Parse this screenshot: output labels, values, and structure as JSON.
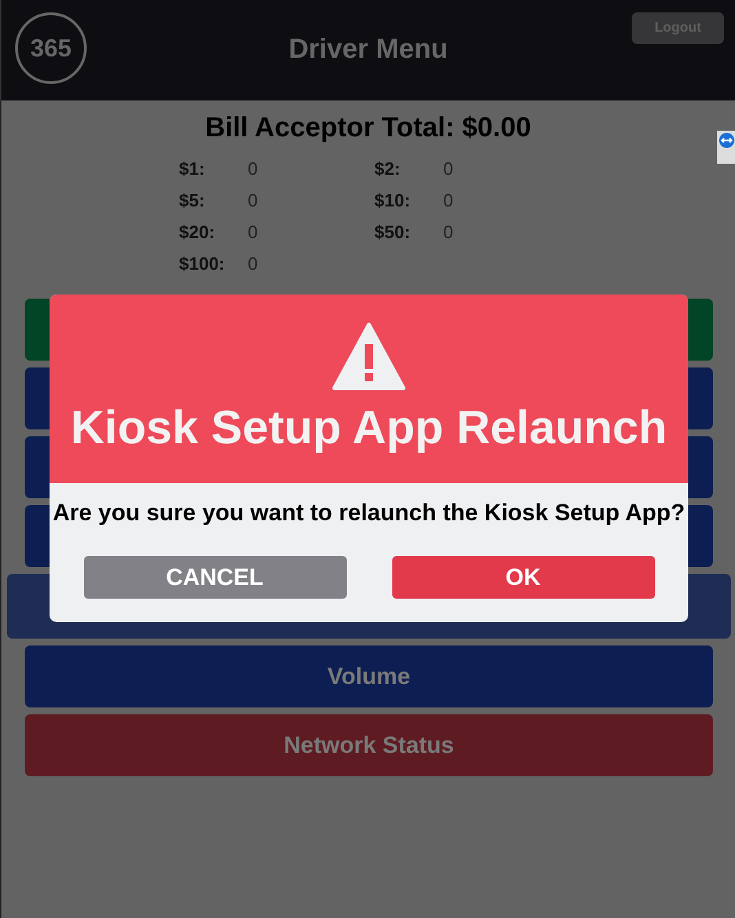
{
  "header": {
    "title": "Driver Menu",
    "logout": "Logout",
    "logo": "365"
  },
  "bill_acceptor": {
    "title": "Bill Acceptor Total: $0.00",
    "denominations": [
      {
        "label": "$1:",
        "count": "0"
      },
      {
        "label": "$2:",
        "count": "0"
      },
      {
        "label": "$5:",
        "count": "0"
      },
      {
        "label": "$10:",
        "count": "0"
      },
      {
        "label": "$20:",
        "count": "0"
      },
      {
        "label": "$50:",
        "count": "0"
      },
      {
        "label": "$100:",
        "count": "0"
      }
    ]
  },
  "menu": [
    {
      "color": "#024526",
      "selected": false
    },
    {
      "color": "#0d1f52",
      "selected": false
    },
    {
      "color": "#0d1f52",
      "selected": false
    },
    {
      "color": "#0d1f52",
      "selected": false
    },
    {
      "color": "#1f2d55",
      "selected": true
    },
    {
      "color": "#0d1f52",
      "selected": false,
      "label": "Volume"
    },
    {
      "color": "#5e1c22",
      "selected": false,
      "label": "Network Status"
    }
  ],
  "dialog": {
    "title": "Kiosk Setup App Relaunch",
    "message": "Are you sure you want to relaunch the Kiosk Setup App?",
    "buttons": [
      {
        "label": "CANCEL",
        "kind": "secondary"
      },
      {
        "label": "OK",
        "kind": "primary"
      }
    ]
  }
}
